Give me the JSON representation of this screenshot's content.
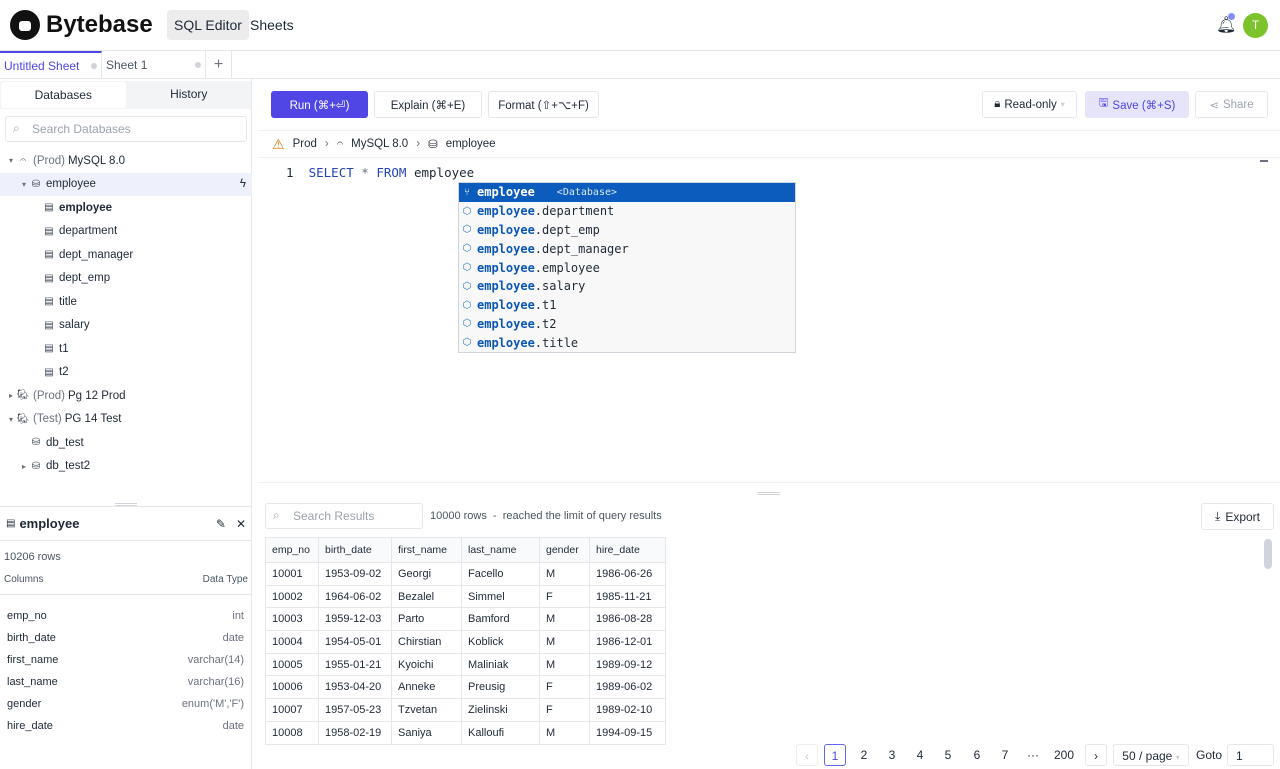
{
  "header": {
    "brand": "Bytebase",
    "nav": [
      "SQL Editor",
      "Sheets"
    ],
    "avatar": "T",
    "accent": "#4f46e5"
  },
  "sheet_tabs": [
    "Untitled Sheet",
    "Sheet 1"
  ],
  "left": {
    "tabs": [
      "Databases",
      "History"
    ],
    "search_placeholder": "Search Databases",
    "tree": [
      {
        "label_prefix": "(Prod)",
        "label": "MySQL 8.0",
        "level": 0,
        "caret": "▾",
        "icon": "mysql-icon"
      },
      {
        "label": "employee",
        "level": 1,
        "caret": "▾",
        "icon": "database-icon",
        "selected": true
      },
      {
        "label": "employee",
        "level": 2,
        "icon": "table-icon",
        "bold": true
      },
      {
        "label": "department",
        "level": 2,
        "icon": "table-icon"
      },
      {
        "label": "dept_manager",
        "level": 2,
        "icon": "table-icon"
      },
      {
        "label": "dept_emp",
        "level": 2,
        "icon": "table-icon"
      },
      {
        "label": "title",
        "level": 2,
        "icon": "table-icon"
      },
      {
        "label": "salary",
        "level": 2,
        "icon": "table-icon"
      },
      {
        "label": "t1",
        "level": 2,
        "icon": "table-icon"
      },
      {
        "label": "t2",
        "level": 2,
        "icon": "table-icon"
      },
      {
        "label_prefix": "(Prod)",
        "label": "Pg 12 Prod",
        "level": 0,
        "caret": "▸",
        "icon": "postgres-icon"
      },
      {
        "label_prefix": "(Test)",
        "label": "PG 14 Test",
        "level": 0,
        "caret": "▾",
        "icon": "postgres-icon"
      },
      {
        "label": "db_test",
        "level": 1,
        "icon": "database-icon"
      },
      {
        "label": "db_test2",
        "level": 1,
        "caret": "▸",
        "icon": "database-icon"
      }
    ]
  },
  "detail": {
    "title": "employee",
    "rows": "10206 rows",
    "col_header": "Columns",
    "type_header": "Data Type",
    "columns": [
      [
        "emp_no",
        "int"
      ],
      [
        "birth_date",
        "date"
      ],
      [
        "first_name",
        "varchar(14)"
      ],
      [
        "last_name",
        "varchar(16)"
      ],
      [
        "gender",
        "enum('M','F')"
      ],
      [
        "hire_date",
        "date"
      ]
    ]
  },
  "toolbar": {
    "run": "Run (⌘+⏎)",
    "explain": "Explain (⌘+E)",
    "format": "Format (⇧+⌥+F)",
    "mode": "Read-only",
    "save": "Save (⌘+S)",
    "share": "Share"
  },
  "breadcrumb": [
    "Prod",
    "MySQL 8.0",
    "employee"
  ],
  "editor": {
    "line": "1",
    "kw1": "SELECT",
    "star": "*",
    "kw2": "FROM",
    "ident": "employee"
  },
  "autocomplete": [
    {
      "prefix": "employee",
      "rest": "",
      "hint": "<Database>"
    },
    {
      "prefix": "employee",
      "rest": ".department"
    },
    {
      "prefix": "employee",
      "rest": ".dept_emp"
    },
    {
      "prefix": "employee",
      "rest": ".dept_manager"
    },
    {
      "prefix": "employee",
      "rest": ".employee"
    },
    {
      "prefix": "employee",
      "rest": ".salary"
    },
    {
      "prefix": "employee",
      "rest": ".t1"
    },
    {
      "prefix": "employee",
      "rest": ".t2"
    },
    {
      "prefix": "employee",
      "rest": ".title"
    }
  ],
  "results": {
    "search_placeholder": "Search Results",
    "status": "10000 rows  -  reached the limit of query results",
    "export": "Export",
    "columns": [
      "emp_no",
      "birth_date",
      "first_name",
      "last_name",
      "gender",
      "hire_date"
    ],
    "rows": [
      [
        "10001",
        "1953-09-02",
        "Georgi",
        "Facello",
        "M",
        "1986-06-26"
      ],
      [
        "10002",
        "1964-06-02",
        "Bezalel",
        "Simmel",
        "F",
        "1985-11-21"
      ],
      [
        "10003",
        "1959-12-03",
        "Parto",
        "Bamford",
        "M",
        "1986-08-28"
      ],
      [
        "10004",
        "1954-05-01",
        "Chirstian",
        "Koblick",
        "M",
        "1986-12-01"
      ],
      [
        "10005",
        "1955-01-21",
        "Kyoichi",
        "Maliniak",
        "M",
        "1989-09-12"
      ],
      [
        "10006",
        "1953-04-20",
        "Anneke",
        "Preusig",
        "F",
        "1989-06-02"
      ],
      [
        "10007",
        "1957-05-23",
        "Tzvetan",
        "Zielinski",
        "F",
        "1989-02-10"
      ],
      [
        "10008",
        "1958-02-19",
        "Saniya",
        "Kalloufi",
        "M",
        "1994-09-15"
      ]
    ]
  },
  "pagination": {
    "pages": [
      "1",
      "2",
      "3",
      "4",
      "5",
      "6",
      "7",
      "···",
      "200"
    ],
    "current": "1",
    "page_size": "50 / page",
    "goto_label": "Goto",
    "goto_value": "1"
  }
}
